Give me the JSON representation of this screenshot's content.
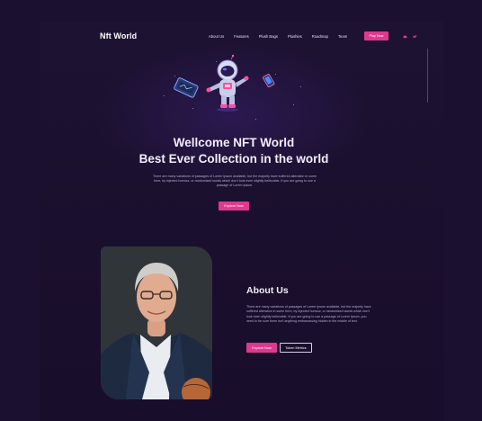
{
  "brand": "Nft World",
  "nav": {
    "items": [
      "About Us",
      "Features",
      "Plush Bags",
      "Plushies",
      "Roadmap",
      "Team"
    ],
    "cta": "Play Now",
    "social": [
      {
        "icon": "discord-icon",
        "color": "#e0388f"
      },
      {
        "icon": "twitter-icon",
        "color": "#e0388f"
      }
    ]
  },
  "hero": {
    "title_line1": "Wellcome NFT World",
    "title_line2": "Best Ever Collection in the world",
    "text": "There are many variations of passages of Lorem Ipsum available, but the majority have suffered alteration in some form, by injected humour, or randomised words which don't look even slightly believable. If you are going to use a passage of Lorem Ipsum.",
    "cta": "Explore Now"
  },
  "about": {
    "title": "About Us",
    "text": "There are many variations of passages of Lorem Ipsum available, but the majority have suffered alteration in some form, by injected humour, or randomised words which don't look even slightly believable. If you are going to use a passage of Lorem Ipsum, you need to be sure there isn't anything embarrassing hidden in the middle of text.",
    "cta_primary": "Explore Now",
    "cta_secondary": "Token Metrics"
  },
  "colors": {
    "accent": "#e0388f",
    "background": "#1b1030"
  }
}
